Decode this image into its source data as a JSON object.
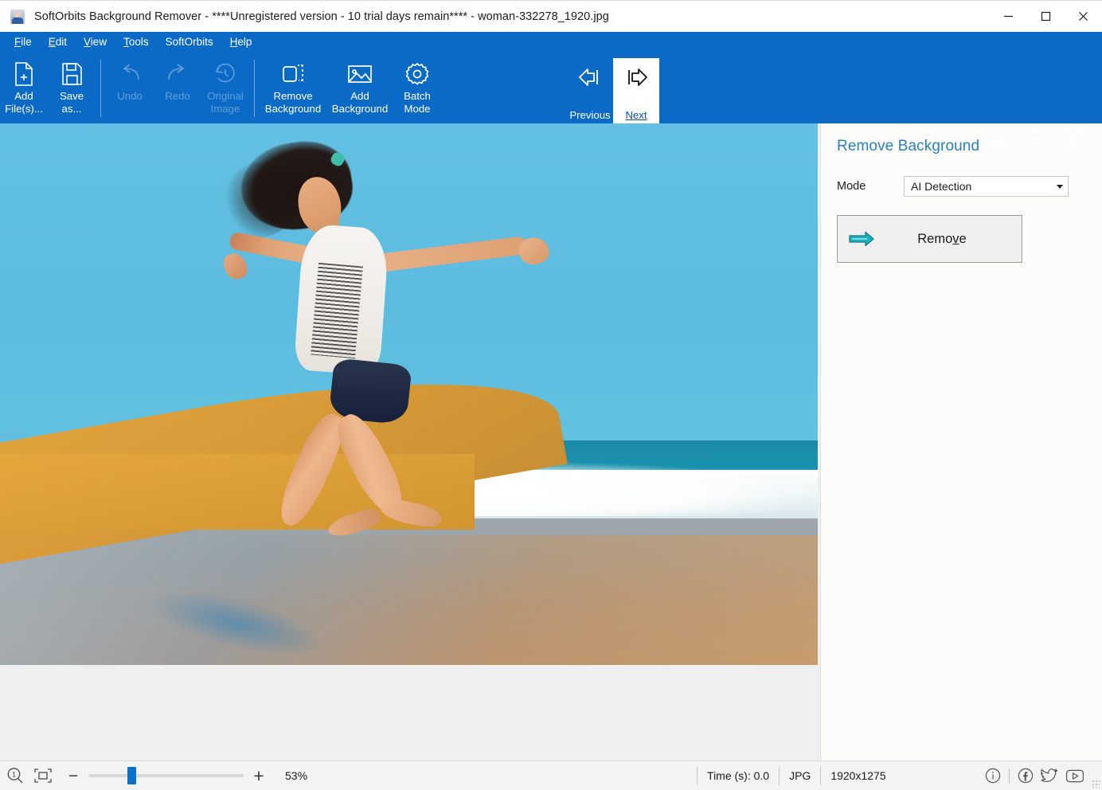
{
  "window": {
    "title": "SoftOrbits Background Remover - ****Unregistered version - 10 trial days remain**** - woman-332278_1920.jpg",
    "app_icon": "app-portrait-icon",
    "controls": {
      "minimize": "minimize-icon",
      "maximize": "maximize-icon",
      "close": "close-icon"
    }
  },
  "menubar": {
    "items": [
      {
        "label": "File",
        "accel": "F",
        "rest": "ile"
      },
      {
        "label": "Edit",
        "accel": "E",
        "rest": "dit"
      },
      {
        "label": "View",
        "accel": "V",
        "rest": "iew"
      },
      {
        "label": "Tools",
        "accel": "T",
        "rest": "ools"
      },
      {
        "label": "SoftOrbits",
        "accel": "",
        "rest": "SoftOrbits"
      },
      {
        "label": "Help",
        "accel": "H",
        "rest": "elp"
      }
    ]
  },
  "toolbar": {
    "add_files": "Add\nFile(s)...",
    "save_as": "Save\nas...",
    "undo": "Undo",
    "redo": "Redo",
    "original_image": "Original\nImage",
    "remove_background": "Remove\nBackground",
    "add_background": "Add\nBackground",
    "batch_mode": "Batch\nMode",
    "previous": "Previous",
    "next": "Next",
    "right_icons": [
      "cart-icon",
      "key-icon",
      "box-icon"
    ]
  },
  "sidebar": {
    "header": "Remove Background",
    "mode_label": "Mode",
    "mode_value": "AI Detection",
    "remove_button": "Remove",
    "remove_accel": "v"
  },
  "statusbar": {
    "zoom_100_icon": "zoom-100-icon",
    "fit_icon": "fit-to-window-icon",
    "zoom_out": "−",
    "zoom_in": "+",
    "zoom_percent": "53%",
    "slider_position_percent": 25,
    "time": "Time (s): 0.0",
    "format": "JPG",
    "dimensions": "1920x1275",
    "social": [
      "info-icon",
      "facebook-icon",
      "twitter-icon",
      "youtube-icon"
    ]
  },
  "colors": {
    "toolbar_blue": "#0a6ac5",
    "sidebar_header_blue": "#2981b8",
    "accent_teal": "#13a5b0",
    "slider_blue": "#0a72cb",
    "canvas_gray": "#efefef"
  },
  "image": {
    "description": "Photo of a woman jumping on a beach with blue sky and ocean waves"
  }
}
